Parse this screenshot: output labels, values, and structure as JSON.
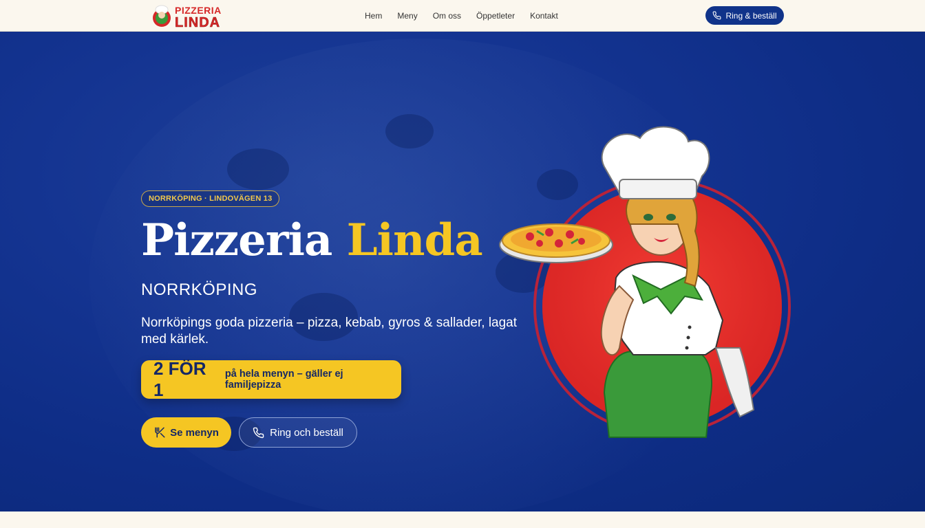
{
  "header": {
    "logo": {
      "line1": "PIZZERIA",
      "line2": "LINDA",
      "icon": "chef-logo-icon"
    },
    "nav": [
      {
        "label": "Hem"
      },
      {
        "label": "Meny"
      },
      {
        "label": "Om oss"
      },
      {
        "label": "Öppetleter"
      },
      {
        "label": "Kontakt"
      }
    ],
    "call_button": {
      "label": "Ring & beställ",
      "icon": "phone-icon"
    }
  },
  "hero": {
    "badge": "NORRKÖPING · LINDOVÄGEN 13",
    "title_main": "Pizzeria",
    "title_accent": "Linda",
    "subtitle": "NORRKÖPING",
    "tagline": "Norrköpings goda pizzeria – pizza, kebab, gyros & sallader, lagat med kärlek.",
    "offer": {
      "big": "2 FÖR 1",
      "small": "på hela menyn – gäller ej familjepizza"
    },
    "menu_button": {
      "label": "Se menyn",
      "icon": "utensils-icon"
    },
    "call_button": {
      "label": "Ring och beställ",
      "icon": "phone-icon"
    },
    "illustration": "chef-woman-with-pizza"
  },
  "colors": {
    "brand_blue": "#10338a",
    "accent_yellow": "#f5c623",
    "logo_red": "#d62828",
    "header_bg": "#fbf7ee"
  }
}
